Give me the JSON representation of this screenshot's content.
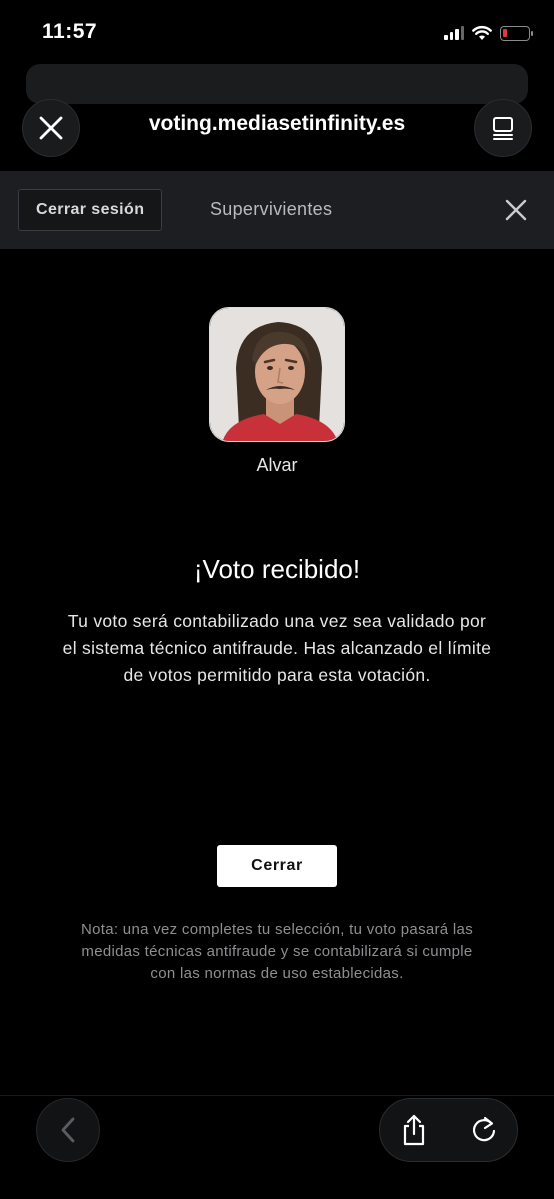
{
  "status_bar": {
    "time": "11:57",
    "icons": [
      "cellular-signal-icon",
      "wifi-icon",
      "battery-icon"
    ],
    "battery_color": "#e03b3b"
  },
  "browser": {
    "url": "voting.mediasetinfinity.es",
    "close_icon": "close-icon",
    "tabs_icon": "tabs-icon"
  },
  "header": {
    "logout_label": "Cerrar sesión",
    "title": "Supervivientes",
    "close_icon": "close-icon",
    "background": "#1c1e21"
  },
  "candidate": {
    "name": "Alvar"
  },
  "result": {
    "title": "¡Voto recibido!",
    "message": "Tu voto será contabilizado una vez sea validado por el sistema técnico antifraude. Has alcanzado el límite de votos permitido para esta votación."
  },
  "close_button_label": "Cerrar",
  "note": "Nota: una vez completes tu selección, tu voto pasará las medidas técnicas antifraude y se contabilizará si cumple con las normas de uso establecidas.",
  "toolbar": {
    "icons": [
      "back-chevron-icon",
      "share-icon",
      "reload-icon"
    ]
  }
}
